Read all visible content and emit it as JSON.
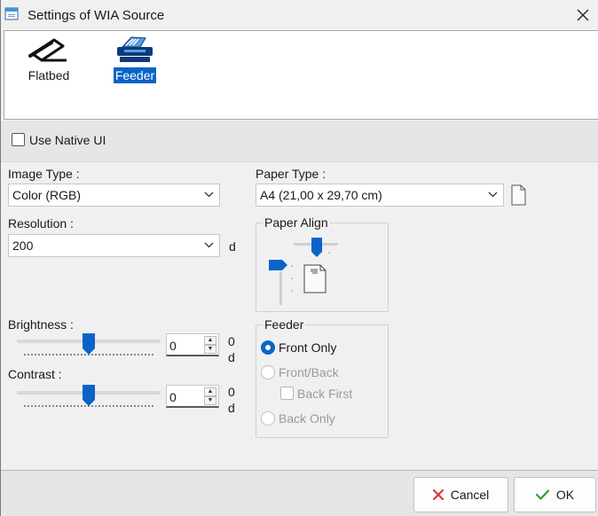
{
  "window": {
    "title": "Settings of WIA Source"
  },
  "sources": [
    {
      "label": "Flatbed",
      "icon": "flatbed-scanner-icon",
      "selected": false
    },
    {
      "label": "Feeder",
      "icon": "feeder-scanner-icon",
      "selected": true
    }
  ],
  "native_ui": {
    "label": "Use Native UI",
    "checked": false
  },
  "image_type": {
    "label": "Image Type :",
    "value": "Color (RGB)"
  },
  "paper_type": {
    "label": "Paper Type :",
    "value": "A4 (21,00 x 29,70 cm)"
  },
  "resolution": {
    "label": "Resolution :",
    "value": "200",
    "unit": "d"
  },
  "paper_align": {
    "caption": "Paper Align"
  },
  "brightness": {
    "label": "Brightness :",
    "value": "0",
    "unit_top": "0",
    "unit_bottom": "d",
    "slider_fraction": 0.5
  },
  "contrast": {
    "label": "Contrast :",
    "value": "0",
    "unit_top": "0",
    "unit_bottom": "d",
    "slider_fraction": 0.5
  },
  "feeder": {
    "caption": "Feeder",
    "front_only": "Front Only",
    "front_back": "Front/Back",
    "back_first": "Back First",
    "back_only": "Back Only",
    "selected": "front_only"
  },
  "buttons": {
    "cancel": "Cancel",
    "ok": "OK"
  },
  "colors": {
    "accent": "#0a64c8",
    "cancel_icon": "#d83b3b",
    "ok_icon": "#2a9d3a"
  }
}
